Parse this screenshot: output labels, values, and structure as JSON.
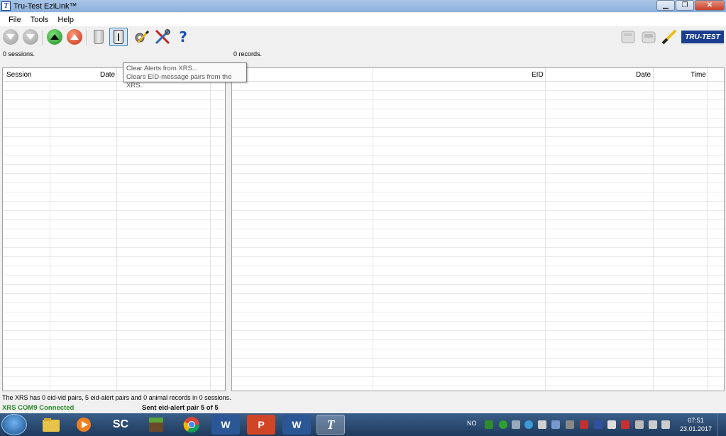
{
  "window": {
    "title": "Tru-Test EziLink™",
    "app_icon_letter": "T"
  },
  "window_controls": {
    "minimize": "▁",
    "maximize": "❐",
    "close": "✕"
  },
  "menu": [
    "File",
    "Tools",
    "Help"
  ],
  "toolbar": {
    "buttons": [
      {
        "name": "download-disabled",
        "icon": "arrow-down-circle-grey"
      },
      {
        "name": "download-disabled-2",
        "icon": "arrow-down-circle-grey"
      },
      {
        "name": "upload-green",
        "icon": "arrow-up-circle-green"
      },
      {
        "name": "upload-red",
        "icon": "arrow-up-circle-red"
      },
      {
        "name": "delete-disabled",
        "icon": "trash-icon"
      },
      {
        "name": "clear-alerts",
        "icon": "trash-icon-active"
      },
      {
        "name": "settings-wand",
        "icon": "gear-wand-icon"
      },
      {
        "name": "tools",
        "icon": "tools-icon"
      },
      {
        "name": "help",
        "icon": "help-icon",
        "label": "?"
      }
    ],
    "logo": "TRU-TEST"
  },
  "info": {
    "sessions": "0 sessions.",
    "records": "0 records."
  },
  "sessions_table": {
    "columns": [
      "Session",
      "Date"
    ]
  },
  "records_table": {
    "columns": [
      "EID",
      "Date",
      "Time"
    ]
  },
  "tooltip": {
    "title": "Clear Alerts from XRS...",
    "description": "Clears EID-message pairs from the XRS."
  },
  "status": {
    "summary": "The XRS has 0 eid-vid pairs, 5 eid-alert pairs and 0 animal records in 0 sessions.",
    "connection": "XRS COM9 Connected",
    "message": "Sent eid-alert pair 5 of 5"
  },
  "taskbar": {
    "apps": [
      "Explorer",
      "Media Player",
      "SC",
      "Minecraft",
      "Chrome",
      "Word",
      "PowerPoint",
      "Word 2",
      "Tru-Test"
    ],
    "sc_label": "SC",
    "word_label": "W",
    "ppt_label": "P",
    "tt_label": "T",
    "language": "NO",
    "time": "07:51",
    "date": "23.01.2017"
  }
}
